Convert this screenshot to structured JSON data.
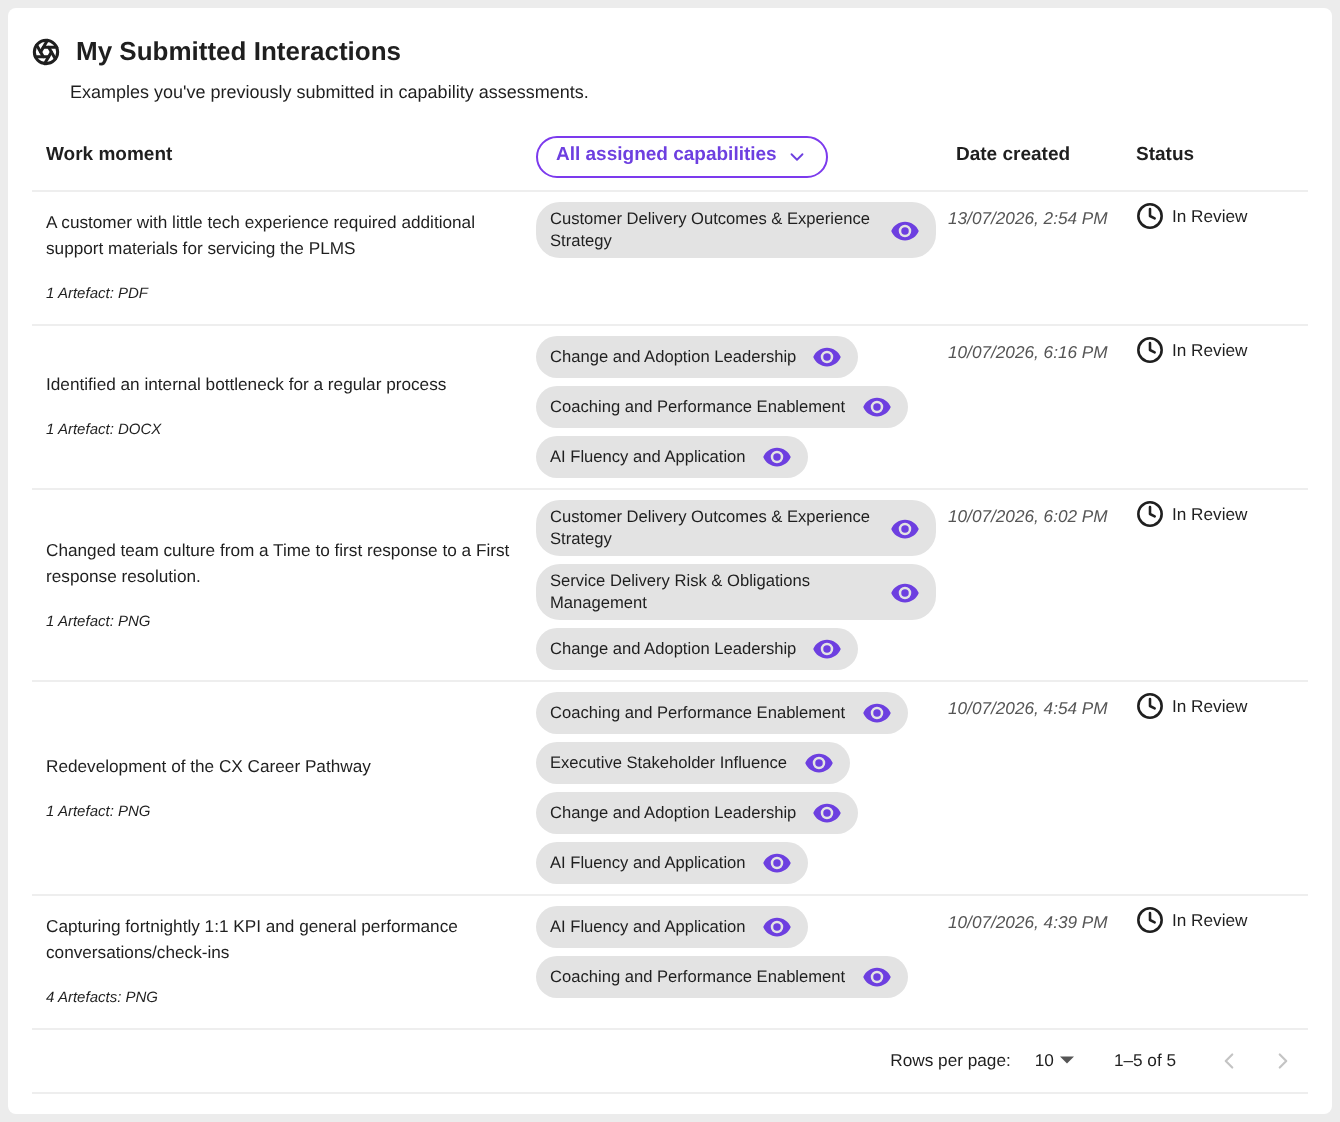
{
  "header": {
    "title": "My Submitted Interactions",
    "subtitle": "Examples you've previously submitted in capability assessments."
  },
  "columns": {
    "work_moment": "Work moment",
    "capability_filter": "All assigned capabilities",
    "date_created": "Date created",
    "status": "Status"
  },
  "rows": [
    {
      "work_moment": "A customer with little tech experience required additional support materials for servicing the PLMS",
      "artefacts": "1 Artefact: PDF",
      "capabilities": [
        "Customer Delivery Outcomes & Experience Strategy"
      ],
      "date": "13/07/2026, 2:54 PM",
      "status": "In Review"
    },
    {
      "work_moment": "Identified an internal bottleneck for a regular process",
      "artefacts": "1 Artefact: DOCX",
      "capabilities": [
        "Change and Adoption Leadership",
        "Coaching and Performance Enablement",
        "AI Fluency and Application"
      ],
      "date": "10/07/2026, 6:16 PM",
      "status": "In Review"
    },
    {
      "work_moment": "Changed team culture from a Time to first response to a First response resolution.",
      "artefacts": "1 Artefact: PNG",
      "capabilities": [
        "Customer Delivery Outcomes & Experience Strategy",
        "Service Delivery Risk & Obligations Management",
        "Change and Adoption Leadership"
      ],
      "date": "10/07/2026, 6:02 PM",
      "status": "In Review"
    },
    {
      "work_moment": "Redevelopment of the CX Career Pathway",
      "artefacts": "1 Artefact: PNG",
      "capabilities": [
        "Coaching and Performance Enablement",
        "Executive Stakeholder Influence",
        "Change and Adoption Leadership",
        "AI Fluency and Application"
      ],
      "date": "10/07/2026, 4:54 PM",
      "status": "In Review"
    },
    {
      "work_moment": "Capturing fortnightly 1:1 KPI and general performance conversations/check-ins",
      "artefacts": "4 Artefacts: PNG",
      "capabilities": [
        "AI Fluency and Application",
        "Coaching and Performance Enablement"
      ],
      "date": "10/07/2026, 4:39 PM",
      "status": "In Review"
    }
  ],
  "pagination": {
    "rows_per_page_label": "Rows per page:",
    "rows_per_page": "10",
    "range": "1–5 of 5",
    "previous_disabled": true,
    "next_disabled": true
  }
}
